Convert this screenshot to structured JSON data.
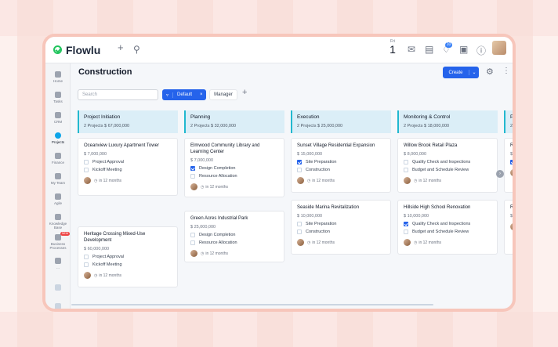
{
  "app": {
    "name": "Flowlu"
  },
  "topbar": {
    "date_dow": "Fri",
    "date_day": "1",
    "notifications_count": "10"
  },
  "sidebar": {
    "items": [
      {
        "label": "Home",
        "icon": "home-icon"
      },
      {
        "label": "Tasks",
        "icon": "tasks-icon"
      },
      {
        "label": "CRM",
        "icon": "crm-icon"
      },
      {
        "label": "Projects",
        "icon": "projects-icon"
      },
      {
        "label": "Finance",
        "icon": "finance-icon"
      },
      {
        "label": "My Team",
        "icon": "team-icon"
      },
      {
        "label": "Agile",
        "icon": "agile-icon"
      },
      {
        "label": "Knowledge Base",
        "icon": "knowledge-icon"
      },
      {
        "label": "Business Processes",
        "icon": "processes-icon",
        "badge": "NEW"
      },
      {
        "label": "…",
        "icon": "more-icon"
      }
    ]
  },
  "page": {
    "title": "Construction",
    "create_label": "Create"
  },
  "toolbar": {
    "search_placeholder": "Search",
    "filter_label": "Default",
    "filter_clear": "×",
    "manager_label": "Manager",
    "add": "+"
  },
  "columns": [
    {
      "name": "Project Initiation",
      "meta": "2 Projects   $ 67,000,000",
      "cards": [
        {
          "title": "Oceanview Luxury Apartment Tower",
          "amount": "$ 7,000,000",
          "tasks": [
            {
              "label": "Project Approval",
              "done": false
            },
            {
              "label": "Kickoff Meeting",
              "done": false
            }
          ],
          "due": "in 12 months"
        },
        {
          "title": "Heritage Crossing Mixed-Use Development",
          "amount": "$ 60,000,000",
          "tasks": [
            {
              "label": "Project Approval",
              "done": false
            },
            {
              "label": "Kickoff Meeting",
              "done": false
            }
          ],
          "due": "in 12 months"
        }
      ]
    },
    {
      "name": "Planning",
      "meta": "2 Projects   $ 32,000,000",
      "cards": [
        {
          "title": "Elmwood Community Library and Learning Center",
          "amount": "$ 7,000,000",
          "tasks": [
            {
              "label": "Design Completion",
              "done": true
            },
            {
              "label": "Resource Allocation",
              "done": false
            }
          ],
          "due": "in 12 months"
        },
        {
          "title": "Green Acres Industrial Park",
          "amount": "$ 25,000,000",
          "tasks": [
            {
              "label": "Design Completion",
              "done": false
            },
            {
              "label": "Resource Allocation",
              "done": false
            }
          ],
          "due": "in 12 months"
        }
      ]
    },
    {
      "name": "Execution",
      "meta": "2 Projects   $ 25,000,000",
      "cards": [
        {
          "title": "Sunset Village Residential Expansion",
          "amount": "$ 15,000,000",
          "tasks": [
            {
              "label": "Site Preparation",
              "done": true
            },
            {
              "label": "Construction",
              "done": false
            }
          ],
          "due": "in 12 months"
        },
        {
          "title": "Seaside Marina Revitalization",
          "amount": "$ 10,000,000",
          "tasks": [
            {
              "label": "Site Preparation",
              "done": false
            },
            {
              "label": "Construction",
              "done": false
            }
          ],
          "due": "in 12 months"
        }
      ]
    },
    {
      "name": "Monitoring & Control",
      "meta": "2 Projects   $ 18,000,000",
      "cards": [
        {
          "title": "Willow Brook Retail Plaza",
          "amount": "$ 8,000,000",
          "tasks": [
            {
              "label": "Quality Check and Inspections",
              "done": false
            },
            {
              "label": "Budget and Schedule Review",
              "done": false
            }
          ],
          "due": "in 12 months"
        },
        {
          "title": "Hillside High School Renovation",
          "amount": "$ 10,000,000",
          "tasks": [
            {
              "label": "Quality Check and Inspections",
              "done": true
            },
            {
              "label": "Budget and Schedule Review",
              "done": false
            }
          ],
          "due": "in 12 months"
        }
      ]
    },
    {
      "name": "Pr",
      "meta": "2",
      "cards": [
        {
          "title": "Ri",
          "amount": "$",
          "tasks": [
            {
              "label": "",
              "done": true
            }
          ],
          "due": ""
        },
        {
          "title": "Ri",
          "amount": "$",
          "tasks": [],
          "due": ""
        }
      ]
    }
  ],
  "colors": {
    "accent": "#2563eb",
    "column_header": "#dbeef7",
    "column_accent": "#22b8cf",
    "logo_green": "#22c55e"
  }
}
